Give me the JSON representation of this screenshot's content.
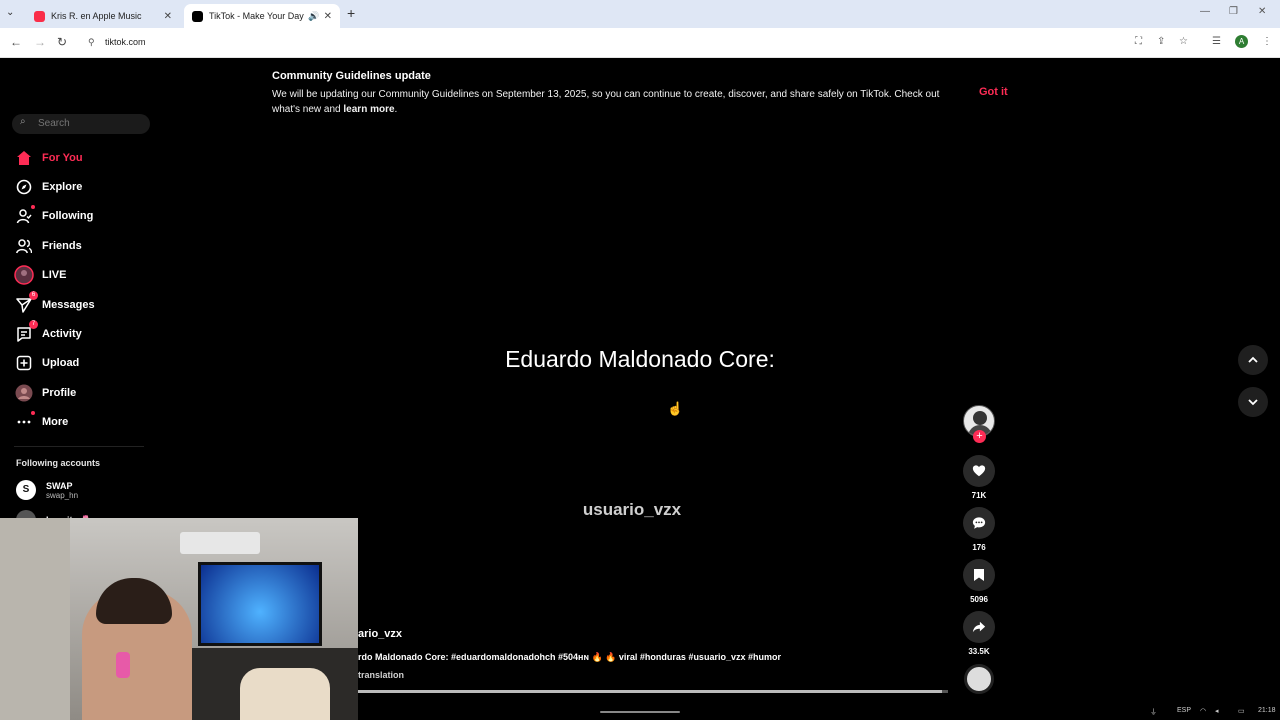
{
  "browser": {
    "tabs": [
      {
        "title": "Kris R. en Apple Music",
        "favicon_color": "#fa2d48"
      },
      {
        "title": "TikTok - Make Your Day",
        "favicon_color": "#000000"
      }
    ],
    "url": "tiktok.com",
    "profile_initial": "A"
  },
  "banner": {
    "title": "Community Guidelines update",
    "body_start": "We will be updating our Community Guidelines on September 13, 2025, so you can continue to create, discover, and share safely on TikTok. Check out what's new and ",
    "learn_more": "learn more",
    "body_end": ".",
    "dismiss": "Got it"
  },
  "sidebar": {
    "search_placeholder": "Search",
    "items": [
      {
        "label": "For You",
        "icon": "home-icon",
        "active": true
      },
      {
        "label": "Explore",
        "icon": "compass-icon"
      },
      {
        "label": "Following",
        "icon": "following-icon",
        "dot": true
      },
      {
        "label": "Friends",
        "icon": "friends-icon"
      },
      {
        "label": "LIVE",
        "icon": "live-icon"
      },
      {
        "label": "Messages",
        "icon": "messages-icon",
        "badge": "6"
      },
      {
        "label": "Activity",
        "icon": "activity-icon",
        "badge": "7"
      },
      {
        "label": "Upload",
        "icon": "upload-icon"
      },
      {
        "label": "Profile",
        "icon": "profile-icon"
      },
      {
        "label": "More",
        "icon": "more-icon",
        "dot": true
      }
    ],
    "following_title": "Following accounts",
    "accounts": [
      {
        "name": "SWAP",
        "handle": "swap_hn"
      },
      {
        "name": "Leanita 🌷",
        "handle": ""
      }
    ]
  },
  "video": {
    "headline": "Eduardo Maldonado Core:",
    "watermark": "usuario_vzx",
    "author": "ario_vzx",
    "caption": "rdo Maldonado Core: #eduardomaldonadohch #504ʜɴ 🔥 🔥 viral #honduras #usuario_vzx #humor",
    "see_translation": "translation",
    "progress": 0.99
  },
  "actions": {
    "likes": "71K",
    "comments": "176",
    "saves": "5096",
    "shares": "33.5K"
  },
  "tray": {
    "lang": "ESP",
    "time": "21:18"
  },
  "colors": {
    "accent": "#fe2c55",
    "background": "#000000"
  }
}
